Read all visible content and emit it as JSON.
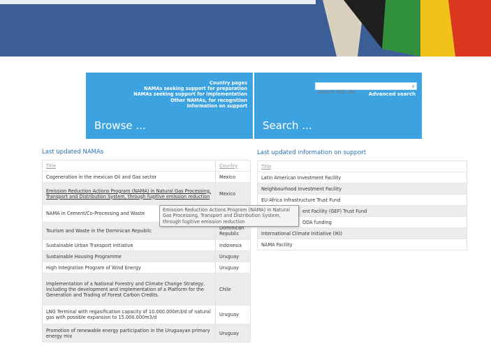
{
  "browse": {
    "links": [
      "Country pages",
      "NAMAs seeking support for preparation",
      "NAMAs seeking support for implementation",
      "Other NAMAs, for recognition",
      "Information on support"
    ],
    "title": "Browse ..."
  },
  "search": {
    "placeholder": "Search this site...",
    "advanced": "Advanced search",
    "title": "Search ..."
  },
  "namas": {
    "heading": "Last updated NAMAs",
    "col_title": "Title",
    "col_country": "Country",
    "rows": [
      {
        "title": "Cogeneration in the mexican Oil and Gas sector",
        "country": "Mexico"
      },
      {
        "title": "Emission Reduction Actions Program (NAMA) in Natural Gas Processing, Transport and Distribution System, through fugitive emission reduction",
        "country": "Mexico"
      },
      {
        "title": "NAMA in Cement/Co-Processing and Waste",
        "country": ""
      },
      {
        "title": "Tourism and Waste in the Dominican Republic",
        "country": "Dominican Republic"
      },
      {
        "title": "Sustainable Urban Transport Initiative",
        "country": "Indonesia"
      },
      {
        "title": "Sustainable Housing Programme",
        "country": "Uruguay"
      },
      {
        "title": "High Integration Program of Wind Energy",
        "country": "Uruguay"
      },
      {
        "title": "Implementation of a National Forestry and Climate Change Strategy, including the development and implementation of a Platform for the Generation and Trading of Forest Carbon Credits.",
        "country": "Chile"
      },
      {
        "title": "LNG Terminal with regasification capacity of 10.000.000m3/d of natural gas with possible expansion to 15.000.000m3/d",
        "country": "Uruguay"
      },
      {
        "title": "Promotion of renewable energy participation in the Uruguayan primary energy mix",
        "country": "Uruguay"
      }
    ]
  },
  "support": {
    "heading": "Last updated information on support",
    "col_title": "Title",
    "rows": [
      "Latin American Investment Facility",
      "Neighbourhood Investment Facility",
      "EU-Africa Infrastructure Trust Fund",
      "ent Facility (GEF) Trust Fund",
      "ODA funding",
      "International Climate Initiative (IKI)",
      "NAMA Facility"
    ]
  },
  "tooltip": "Emission Reduction Actions Program (NAMA) in Natural Gas Processing, Transport and Distribution System, through fugitive emission reduction"
}
